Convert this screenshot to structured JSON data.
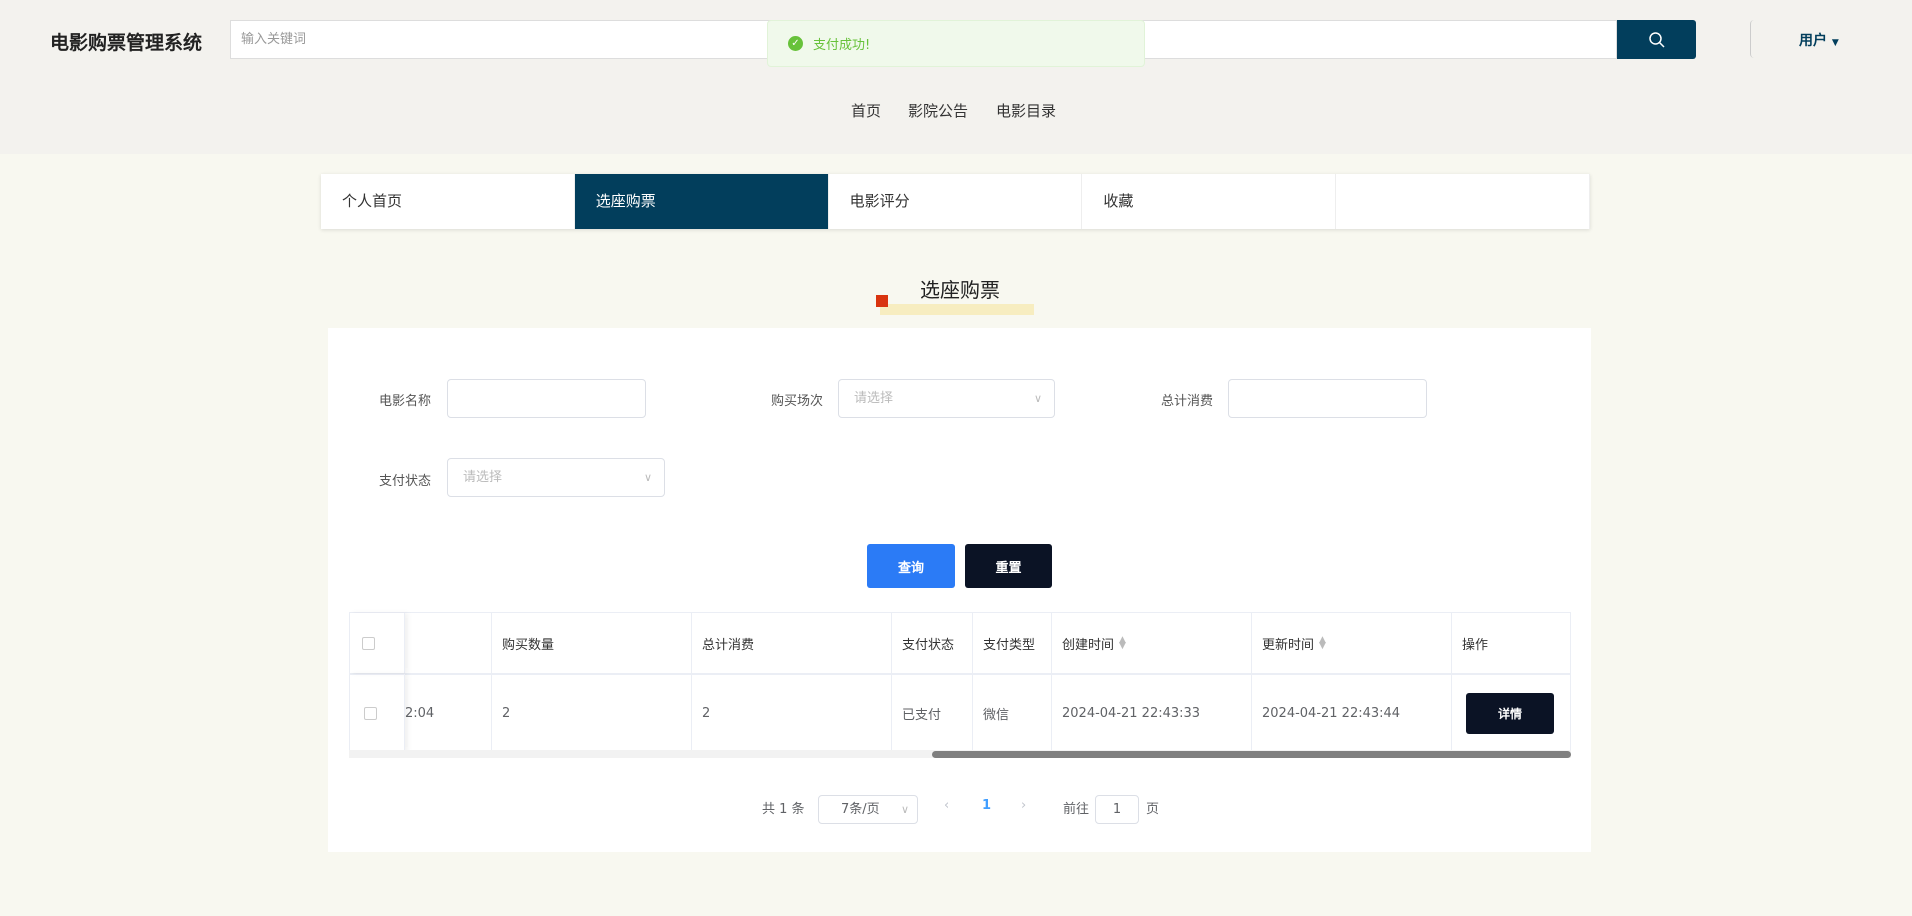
{
  "header": {
    "title": "电影购票管理系统",
    "search_placeholder": "输入关键词",
    "user": "用户"
  },
  "toast": {
    "message": "支付成功!"
  },
  "nav": [
    "首页",
    "影院公告",
    "电影目录"
  ],
  "tabs": [
    "个人首页",
    "选座购票",
    "电影评分",
    "收藏"
  ],
  "section_title": "选座购票",
  "form": {
    "movie_name_label": "电影名称",
    "movie_name_value": "",
    "session_label": "购买场次",
    "session_placeholder": "请选择",
    "total_label": "总计消费",
    "total_value": "",
    "pay_status_label": "支付状态",
    "pay_status_placeholder": "请选择",
    "query": "查询",
    "reset": "重置"
  },
  "table": {
    "headers": [
      "",
      "购买数量",
      "总计消费",
      "支付状态",
      "支付类型",
      "创建时间",
      "更新时间",
      "操作"
    ],
    "rows": [
      {
        "time": "2:04",
        "qty": "2",
        "total": "2",
        "status": "已支付",
        "type": "微信",
        "created": "2024-04-21 22:43:33",
        "updated": "2024-04-21 22:43:44",
        "action": "详情"
      }
    ]
  },
  "pagination": {
    "total": "共 1 条",
    "page_size": "7条/页",
    "current": "1",
    "goto_label": "前往",
    "goto_value": "1",
    "page_suffix": "页"
  },
  "colors": {
    "primary": "#023e5c",
    "query_btn": "#2b7bf6",
    "dark_btn": "#0b1325",
    "success": "#67c23a"
  }
}
